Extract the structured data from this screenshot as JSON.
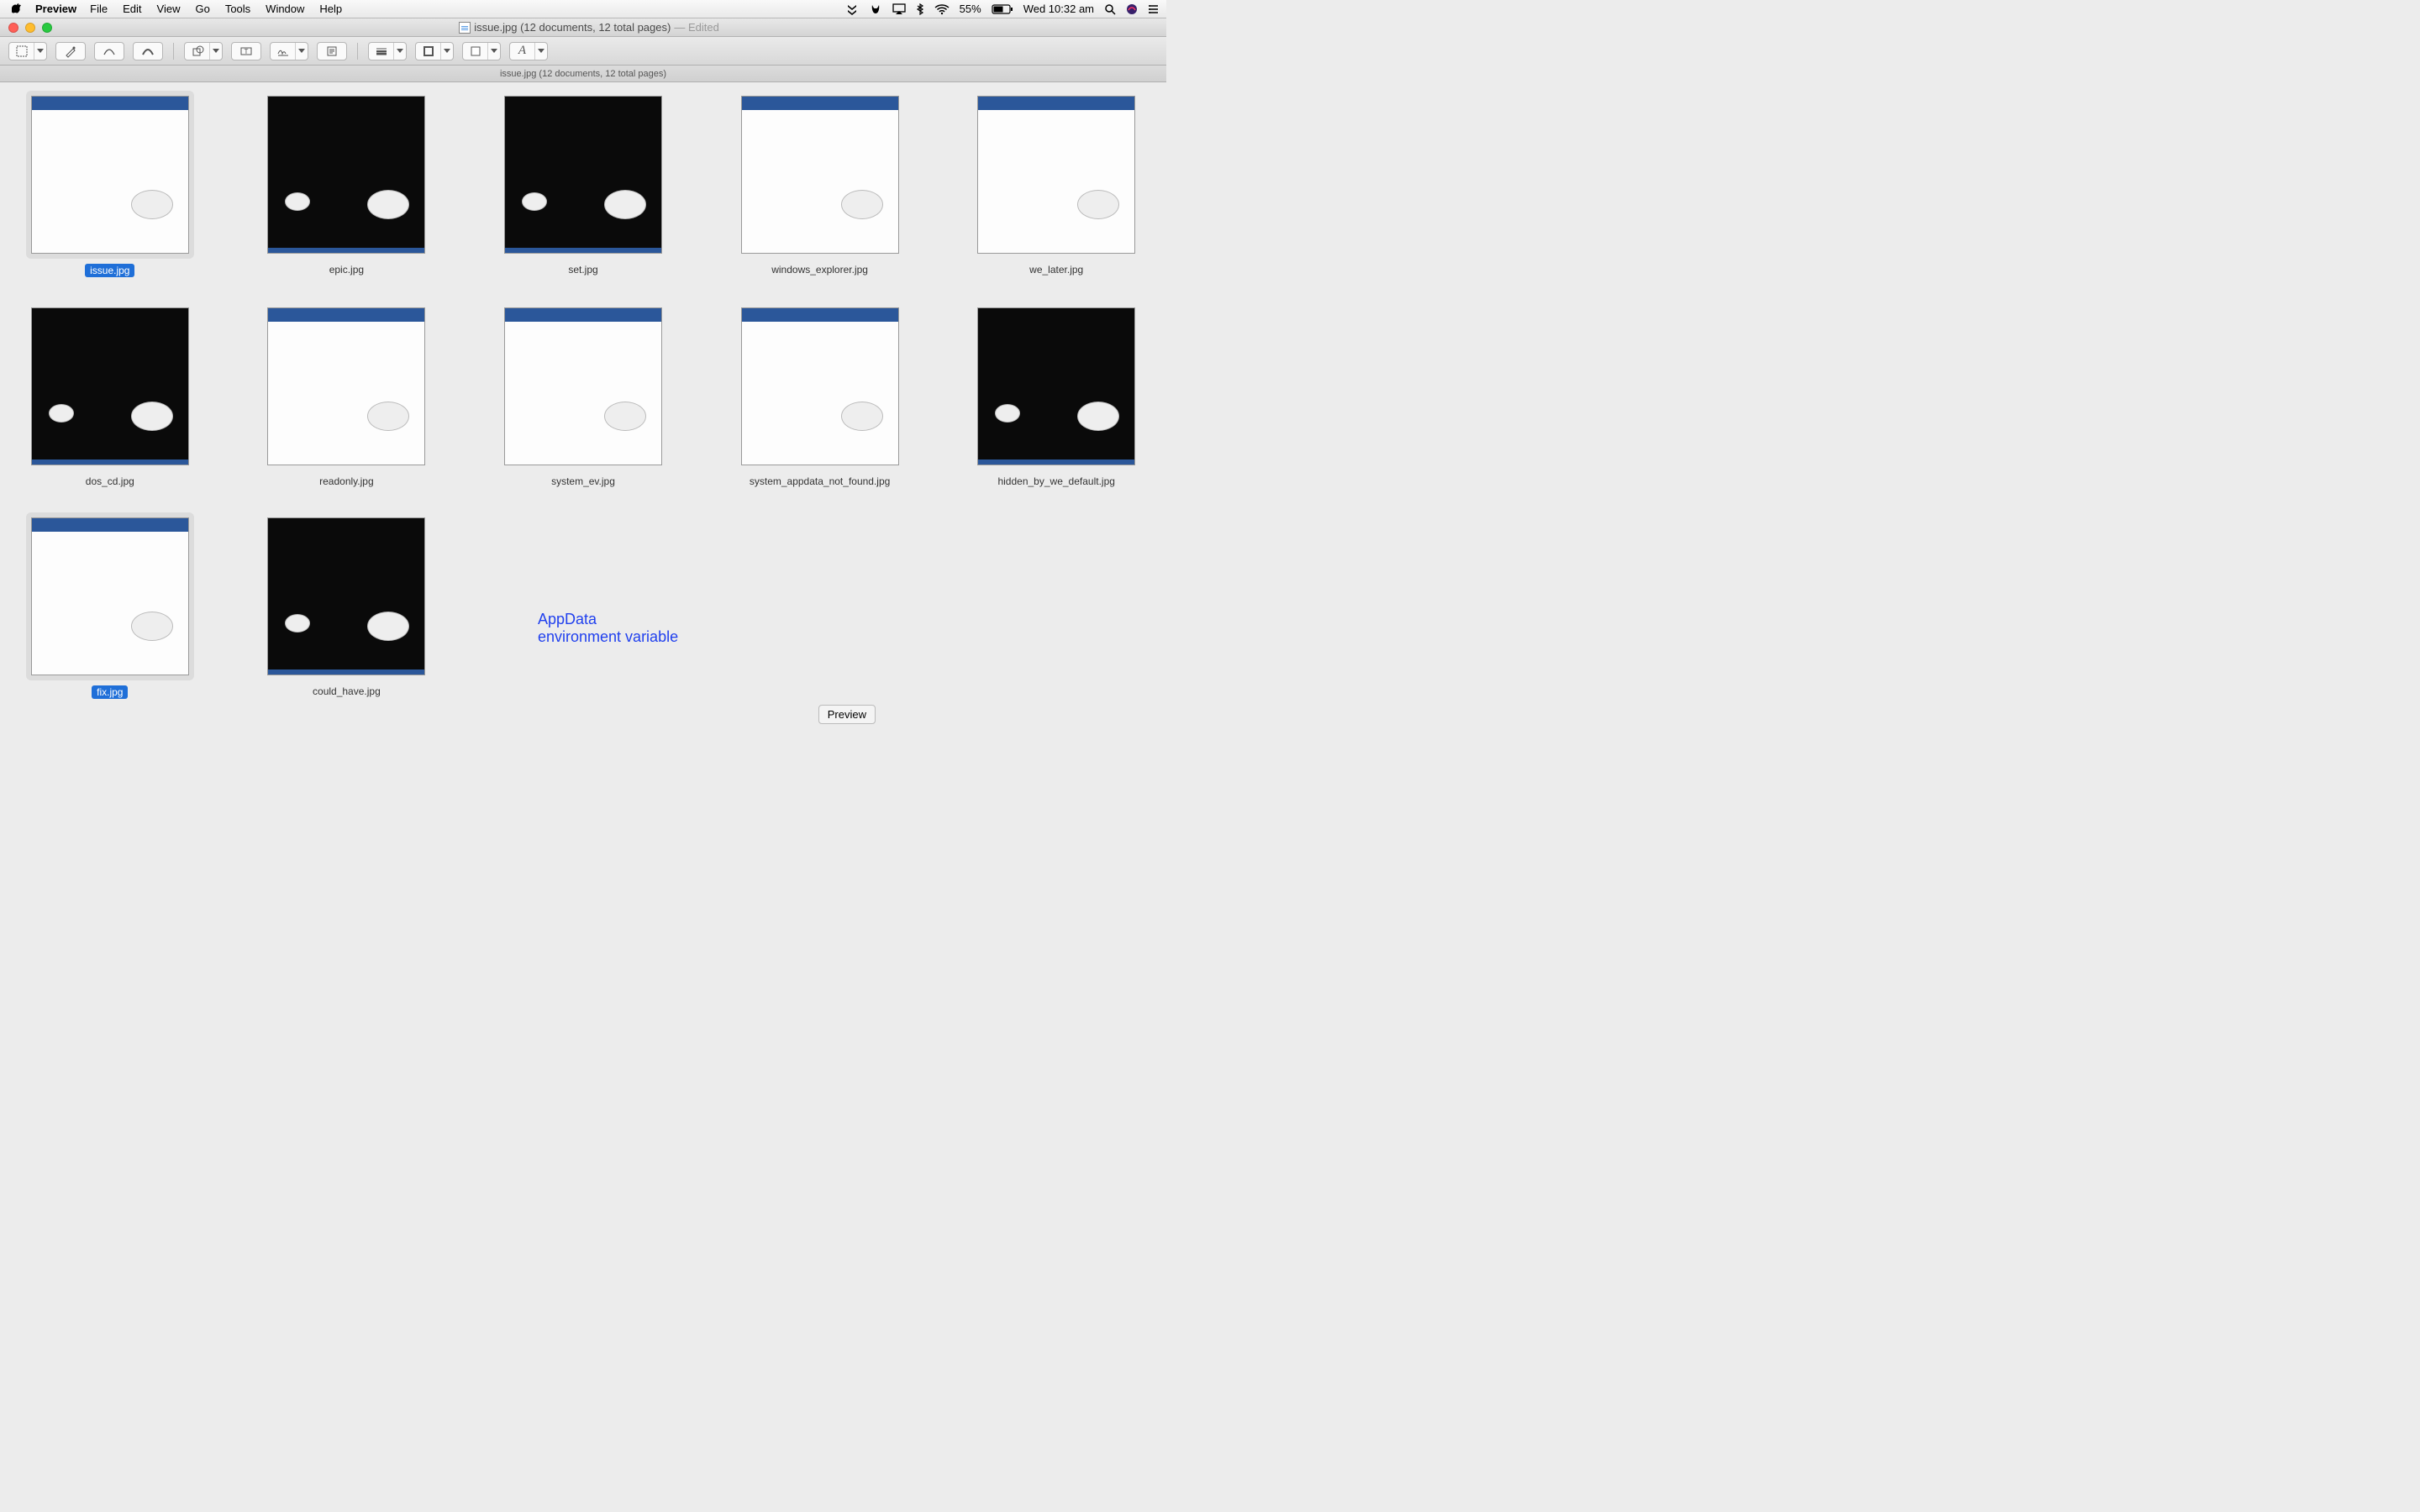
{
  "menubar": {
    "app_name": "Preview",
    "items": [
      "File",
      "Edit",
      "View",
      "Go",
      "Tools",
      "Window",
      "Help"
    ],
    "battery": "55%",
    "clock": "Wed 10:32 am"
  },
  "window": {
    "title_main": "issue.jpg (12 documents, 12 total pages)",
    "title_suffix": "— Edited"
  },
  "tabbar": {
    "label": "issue.jpg (12 documents, 12 total pages)"
  },
  "text_overlay": {
    "line1": "AppData",
    "line2": "environment variable"
  },
  "dock_tooltip": "Preview",
  "thumbs": [
    {
      "name": "issue.jpg",
      "kind": "word",
      "selected": true
    },
    {
      "name": "epic.jpg",
      "kind": "terminal",
      "selected": false
    },
    {
      "name": "set.jpg",
      "kind": "terminal",
      "selected": false
    },
    {
      "name": "windows_explorer.jpg",
      "kind": "word",
      "selected": false
    },
    {
      "name": "we_later.jpg",
      "kind": "word",
      "selected": false
    },
    {
      "name": "dos_cd.jpg",
      "kind": "terminal",
      "selected": false
    },
    {
      "name": "readonly.jpg",
      "kind": "word",
      "selected": false
    },
    {
      "name": "system_ev.jpg",
      "kind": "word",
      "selected": false
    },
    {
      "name": "system_appdata_not_found.jpg",
      "kind": "word",
      "selected": false
    },
    {
      "name": "hidden_by_we_default.jpg",
      "kind": "terminal",
      "selected": false
    },
    {
      "name": "fix.jpg",
      "kind": "word",
      "selected": true
    },
    {
      "name": "could_have.jpg",
      "kind": "terminal",
      "selected": false
    }
  ]
}
